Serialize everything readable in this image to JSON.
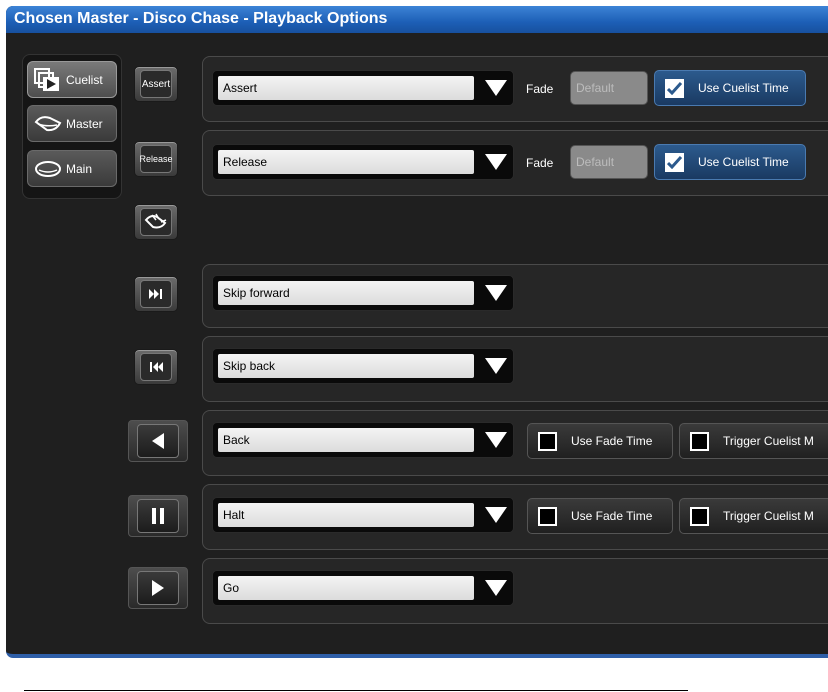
{
  "window": {
    "title": "Chosen Master - Disco Chase - Playback Options"
  },
  "tabs": [
    {
      "label": "Cuelist",
      "icon": "cuelist-icon",
      "active": true
    },
    {
      "label": "Master",
      "icon": "master-icon",
      "active": false
    },
    {
      "label": "Main",
      "icon": "main-icon",
      "active": false
    }
  ],
  "buttons": {
    "assert": "Assert",
    "release": "Release",
    "flash_icon": "flash-hand-icon",
    "skip_forward_icon": "skip-forward-icon",
    "skip_back_icon": "skip-back-icon",
    "back_icon": "back-triangle-icon",
    "halt_icon": "pause-icon",
    "go_icon": "play-triangle-icon"
  },
  "rows": {
    "assert": {
      "value": "Assert",
      "fade_label": "Fade",
      "fade_placeholder": "Default",
      "use_cuelist_time": "Use Cuelist Time",
      "checked": true
    },
    "release": {
      "value": "Release",
      "fade_label": "Fade",
      "fade_placeholder": "Default",
      "use_cuelist_time": "Use Cuelist Time",
      "checked": true
    },
    "skip_forward": {
      "value": "Skip forward"
    },
    "skip_back": {
      "value": "Skip back"
    },
    "back": {
      "value": "Back",
      "use_fade_time": "Use Fade Time",
      "trigger_cuelist": "Trigger Cuelist M"
    },
    "halt": {
      "value": "Halt",
      "use_fade_time": "Use Fade Time",
      "trigger_cuelist": "Trigger Cuelist M"
    },
    "go": {
      "value": "Go"
    }
  },
  "colors": {
    "title_bar": "#1d5fb6",
    "accent_checkbox": "#2c5a8d",
    "background": "#1f1f1f"
  }
}
